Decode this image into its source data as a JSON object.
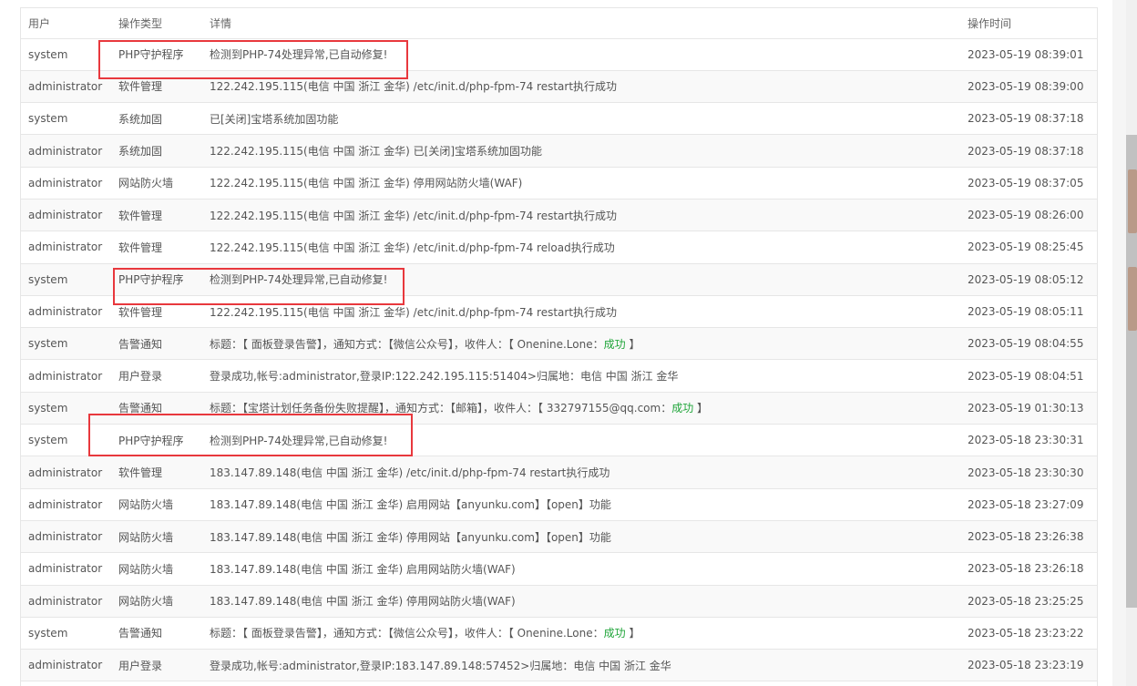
{
  "table": {
    "headers": {
      "user": "用户",
      "type": "操作类型",
      "detail": "详情",
      "time": "操作时间"
    },
    "rows": [
      {
        "user": "system",
        "type": "PHP守护程序",
        "detail": "检测到PHP-74处理异常,已自动修复!",
        "status": "",
        "tail": "",
        "time": "2023-05-19 08:39:01"
      },
      {
        "user": "administrator",
        "type": "软件管理",
        "detail": "122.242.195.115(电信 中国 浙江 金华) /etc/init.d/php-fpm-74 restart执行成功",
        "status": "",
        "tail": "",
        "time": "2023-05-19 08:39:00"
      },
      {
        "user": "system",
        "type": "系统加固",
        "detail": "已[关闭]宝塔系统加固功能",
        "status": "",
        "tail": "",
        "time": "2023-05-19 08:37:18"
      },
      {
        "user": "administrator",
        "type": "系统加固",
        "detail": "122.242.195.115(电信 中国 浙江 金华) 已[关闭]宝塔系统加固功能",
        "status": "",
        "tail": "",
        "time": "2023-05-19 08:37:18"
      },
      {
        "user": "administrator",
        "type": "网站防火墙",
        "detail": "122.242.195.115(电信 中国 浙江 金华) 停用网站防火墙(WAF)",
        "status": "",
        "tail": "",
        "time": "2023-05-19 08:37:05"
      },
      {
        "user": "administrator",
        "type": "软件管理",
        "detail": "122.242.195.115(电信 中国 浙江 金华) /etc/init.d/php-fpm-74 restart执行成功",
        "status": "",
        "tail": "",
        "time": "2023-05-19 08:26:00"
      },
      {
        "user": "administrator",
        "type": "软件管理",
        "detail": "122.242.195.115(电信 中国 浙江 金华) /etc/init.d/php-fpm-74 reload执行成功",
        "status": "",
        "tail": "",
        "time": "2023-05-19 08:25:45"
      },
      {
        "user": "system",
        "type": "PHP守护程序",
        "detail": "检测到PHP-74处理异常,已自动修复!",
        "status": "",
        "tail": "",
        "time": "2023-05-19 08:05:12"
      },
      {
        "user": "administrator",
        "type": "软件管理",
        "detail": "122.242.195.115(电信 中国 浙江 金华) /etc/init.d/php-fpm-74 restart执行成功",
        "status": "",
        "tail": "",
        "time": "2023-05-19 08:05:11"
      },
      {
        "user": "system",
        "type": "告警通知",
        "detail": "标题：【 面板登录告警】，通知方式：【微信公众号】，收件人：【 Onenine.Lone：",
        "status": "成功",
        "tail": " 】",
        "time": "2023-05-19 08:04:55"
      },
      {
        "user": "administrator",
        "type": "用户登录",
        "detail": "登录成功,帐号:administrator,登录IP:122.242.195.115:51404>归属地：电信 中国 浙江 金华",
        "status": "",
        "tail": "",
        "time": "2023-05-19 08:04:51"
      },
      {
        "user": "system",
        "type": "告警通知",
        "detail": "标题：【宝塔计划任务备份失败提醒】，通知方式：【邮箱】，收件人：【 332797155@qq.com：",
        "status": "成功",
        "tail": " 】",
        "time": "2023-05-19 01:30:13"
      },
      {
        "user": "system",
        "type": "PHP守护程序",
        "detail": "检测到PHP-74处理异常,已自动修复!",
        "status": "",
        "tail": "",
        "time": "2023-05-18 23:30:31"
      },
      {
        "user": "administrator",
        "type": "软件管理",
        "detail": "183.147.89.148(电信 中国 浙江 金华) /etc/init.d/php-fpm-74 restart执行成功",
        "status": "",
        "tail": "",
        "time": "2023-05-18 23:30:30"
      },
      {
        "user": "administrator",
        "type": "网站防火墙",
        "detail": "183.147.89.148(电信 中国 浙江 金华) 启用网站【anyunku.com】【open】功能",
        "status": "",
        "tail": "",
        "time": "2023-05-18 23:27:09"
      },
      {
        "user": "administrator",
        "type": "网站防火墙",
        "detail": "183.147.89.148(电信 中国 浙江 金华) 停用网站【anyunku.com】【open】功能",
        "status": "",
        "tail": "",
        "time": "2023-05-18 23:26:38"
      },
      {
        "user": "administrator",
        "type": "网站防火墙",
        "detail": "183.147.89.148(电信 中国 浙江 金华) 启用网站防火墙(WAF)",
        "status": "",
        "tail": "",
        "time": "2023-05-18 23:26:18"
      },
      {
        "user": "administrator",
        "type": "网站防火墙",
        "detail": "183.147.89.148(电信 中国 浙江 金华) 停用网站防火墙(WAF)",
        "status": "",
        "tail": "",
        "time": "2023-05-18 23:25:25"
      },
      {
        "user": "system",
        "type": "告警通知",
        "detail": "标题：【 面板登录告警】，通知方式：【微信公众号】，收件人：【 Onenine.Lone：",
        "status": "成功",
        "tail": " 】",
        "time": "2023-05-18 23:23:22"
      },
      {
        "user": "administrator",
        "type": "用户登录",
        "detail": "登录成功,帐号:administrator,登录IP:183.147.89.148:57452>归属地：电信 中国 浙江 金华",
        "status": "",
        "tail": "",
        "time": "2023-05-18 23:23:19"
      }
    ]
  },
  "colors": {
    "highlight_box": "#e8383d",
    "success_text": "#20a53a"
  }
}
